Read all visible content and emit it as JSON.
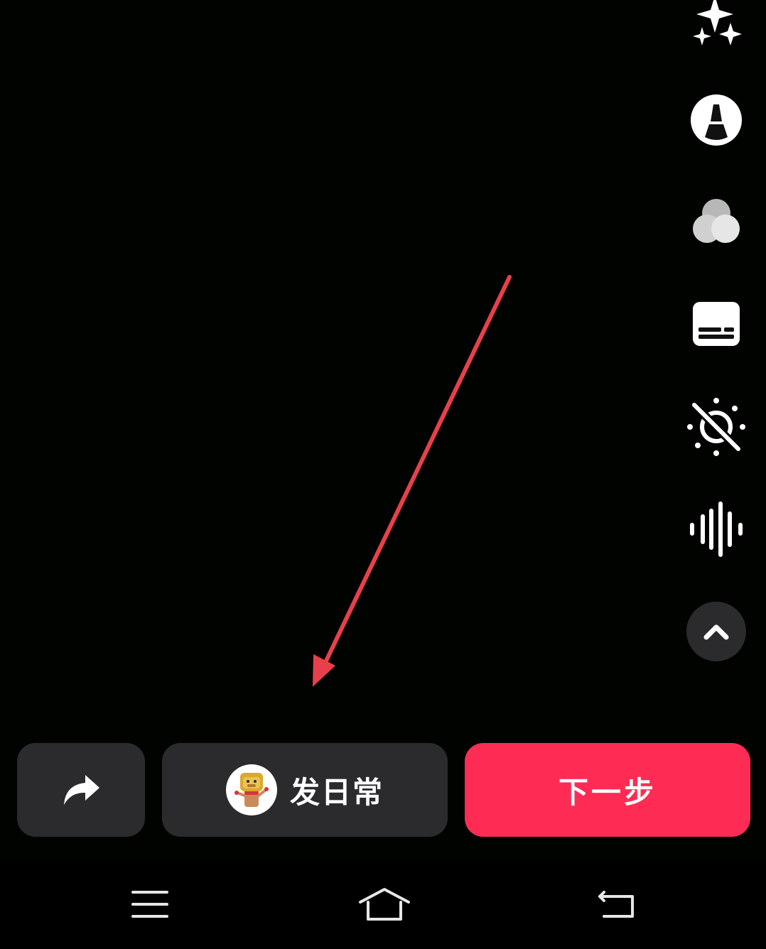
{
  "toolbar": {
    "items": [
      {
        "icon": "sparkle-effects-icon"
      },
      {
        "icon": "beautify-icon"
      },
      {
        "icon": "filter-icon"
      },
      {
        "icon": "subtitle-icon"
      },
      {
        "icon": "flash-off-icon"
      },
      {
        "icon": "audio-wave-icon"
      }
    ],
    "collapse_icon": "chevron-up-icon"
  },
  "bottom": {
    "share_icon": "share-arrow-icon",
    "daily_label": "发日常",
    "next_label": "下一步"
  },
  "nav": {
    "menu_icon": "menu-icon",
    "home_icon": "home-icon",
    "back_icon": "back-icon"
  },
  "colors": {
    "accent": "#fe2c55",
    "button_bg": "#2b2b2d",
    "annotation": "#e8404a"
  }
}
